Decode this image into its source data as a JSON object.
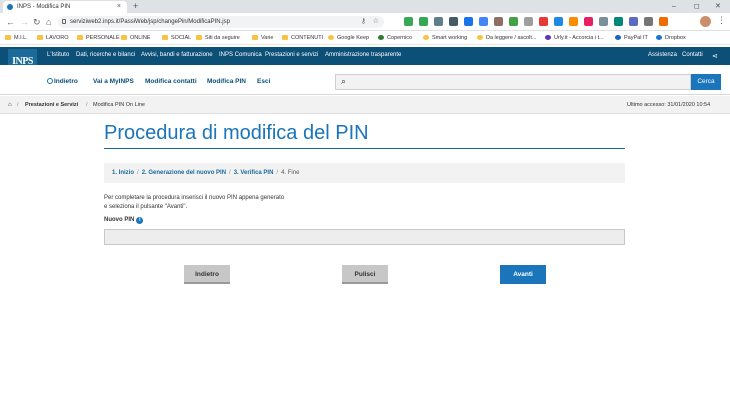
{
  "browser": {
    "tab_title": "INPS - Modifica PIN",
    "tab_close": "×",
    "new_tab": "+",
    "url": "serviziweb2.inps.it/PassiWeb/jsp/changePin/ModificaPIN.jsp",
    "window_controls": [
      "–",
      "◻",
      "✕"
    ],
    "nav_icons": [
      "←",
      "→",
      "↻",
      "⌂"
    ],
    "bookmarks": [
      "M.I.L.",
      "LAVORO",
      "PERSONALE",
      "ONLINE",
      "SOCIAL",
      "Siti da seguire",
      "Varie",
      "CONTENUTI",
      "Google Keep",
      "Copernico",
      "Smart working",
      "Da leggere / ascolt...",
      "Urly.it - Accorcia i t...",
      "PayPal IT",
      "Dropbox"
    ],
    "extension_colors": [
      "#3aa757",
      "#34a853",
      "#607d8b",
      "#455a64",
      "#1a73e8",
      "#4285f4",
      "#8d6e63",
      "#43a047",
      "#9e9e9e",
      "#e53935",
      "#1e88e5",
      "#fb8c00",
      "#e91e63",
      "#78909c",
      "#00897b",
      "#5c6bc0",
      "#757575",
      "#ef6c00"
    ]
  },
  "header": {
    "logo_text": "INPS",
    "top_nav": [
      "L'Istituto",
      "Dati, ricerche e bilanci",
      "Avvisi, bandi e fatturazione",
      "INPS Comunica",
      "Prestazioni e servizi",
      "Amministrazione trasparente"
    ],
    "top_right": [
      "Assistenza",
      "Contatti"
    ],
    "share_icon": "share-icon",
    "back_label": "Indietro",
    "sec_nav": [
      "Vai a MyINPS",
      "Modifica contatti",
      "Modifica PIN",
      "Esci"
    ],
    "search_button": "Cerca",
    "search_placeholder": ""
  },
  "breadcrumb": {
    "home_icon": "home-icon",
    "items": [
      "Prestazioni e Servizi",
      "Modifica PIN On Line"
    ],
    "last_access": "Ultimo accesso: 31/01/2020 10:54"
  },
  "main": {
    "title": "Procedura di modifica del PIN",
    "steps": [
      "1. Inizio",
      "2. Generazione del nuovo PIN",
      "3. Verifica PIN",
      "4. Fine"
    ],
    "instruction_lines": [
      "Per completare la procedura inserisci il nuovo PIN appena generato",
      "e seleziona il pulsante \"Avanti\"."
    ],
    "pin_label": "Nuovo PIN",
    "pin_value": "",
    "buttons": {
      "back": "Indietro",
      "clear": "Pulisci",
      "next": "Avanti"
    }
  },
  "colors": {
    "brand_dark": "#0c4f77",
    "brand": "#1a75bb"
  }
}
